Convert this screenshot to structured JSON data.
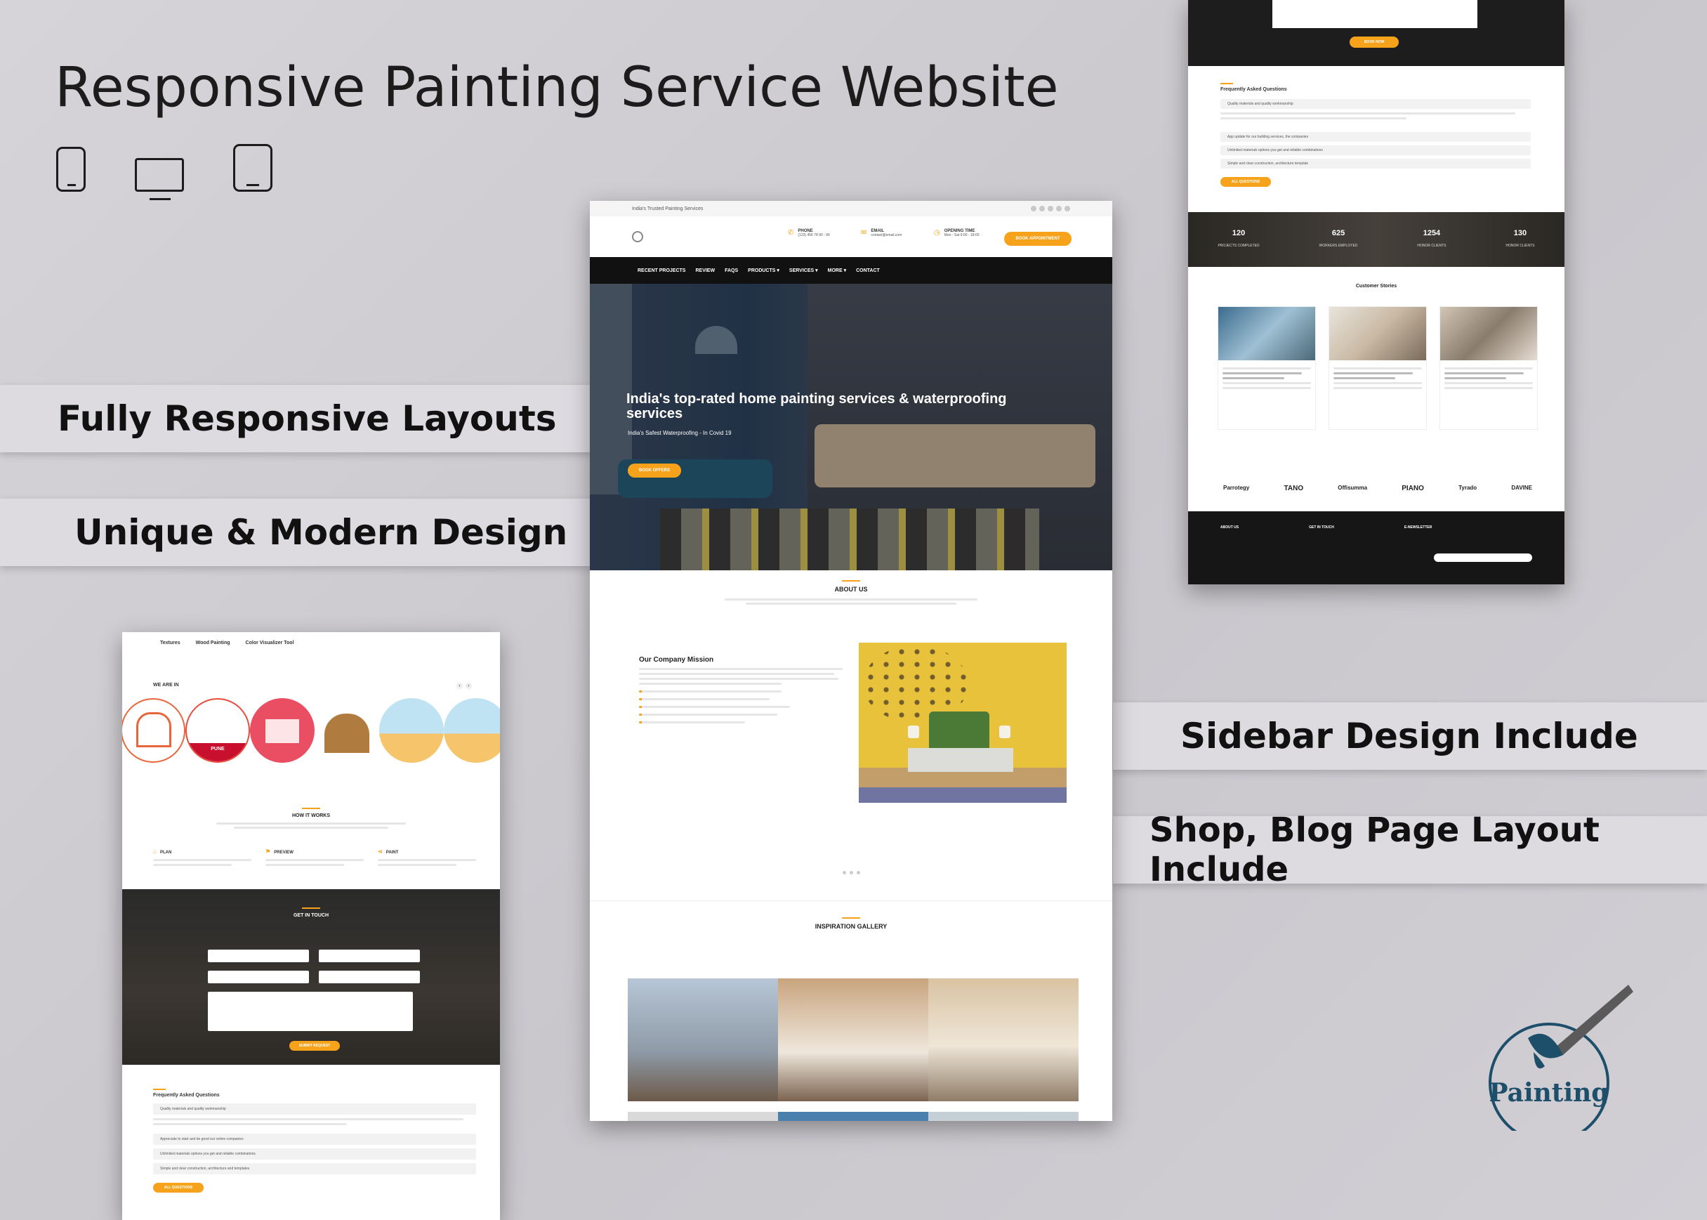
{
  "headline": "Responsive Painting Service Website",
  "features": {
    "f1": "Fully Responsive Layouts",
    "f2": "Unique & Modern Design",
    "f3": "Sidebar Design Include",
    "f4": "Shop, Blog Page Layout Include"
  },
  "brand_logo_text": "Painting",
  "colors": {
    "accent": "#f7a21b",
    "dark": "#111111",
    "logo": "#1d4e6a"
  },
  "main": {
    "topbar": "India's Trusted Painting Services",
    "phone_label": "PHONE",
    "phone_value": "(123) 456 78 90 - 99",
    "email_label": "EMAIL",
    "email_value": "contact@email.com",
    "hours_label": "OPENING TIME",
    "hours_value": "Mon - Sat 9:00 - 18:00",
    "book_button": "BOOK APPOINTMENT",
    "nav": [
      "RECENT PROJECTS",
      "REVIEW",
      "FAQS",
      "PRODUCTS ▾",
      "SERVICES ▾",
      "MORE ▾",
      "CONTACT"
    ],
    "hero_title": "India's top-rated home painting services & waterproofing services",
    "hero_sub": "India's Safest Waterproofing - In Covid 19",
    "hero_button": "BOOK OFFERS",
    "about_title": "ABOUT US",
    "mission_title": "Our Company Mission",
    "gallery_title": "INSPIRATION GALLERY"
  },
  "left": {
    "tabs": [
      "Textures",
      "Wood Painting",
      "Color Visualizer Tool"
    ],
    "we_are_in": "WE ARE IN",
    "city_labels": [
      "PUNE"
    ],
    "how_title": "HOW IT WORKS",
    "steps": [
      "PLAN",
      "PREVIEW",
      "PAINT"
    ],
    "touch_title": "GET IN TOUCH",
    "submit": "SUBMIT REQUEST",
    "faq_title": "Frequently Asked Questions",
    "faq_items": [
      "Quality materials and quality workmanship",
      "Appreciate to start and be good our online companies",
      "Unlimited materials options you get and reliable combinations",
      "Simple and clear construction, architecture and templates"
    ],
    "all_q": "ALL QUESTIONS"
  },
  "right": {
    "button": "BOOK NOW",
    "faq_title": "Frequently Asked Questions",
    "faq_items": [
      "Quality materials and quality workmanship",
      "App update for our building services, the companies",
      "Unlimited materials options you get and reliable combinations",
      "Simple and clear construction, architecture template"
    ],
    "all_q": "ALL QUESTIONS",
    "stats": [
      {
        "value": "120",
        "label": "PROJECTS COMPLETED"
      },
      {
        "value": "625",
        "label": "WORKERS EMPLOYED"
      },
      {
        "value": "1254",
        "label": "HONOR CLIENTS"
      },
      {
        "value": "130",
        "label": "HONOR CLIENTS"
      }
    ],
    "stories_title": "Customer Stories",
    "brands": [
      "Parrotegy",
      "TANO",
      "Offisumma",
      "PIANO",
      "Tyrado",
      "DAVINE"
    ],
    "footer": [
      "ABOUT US",
      "GET IN TOUCH",
      "E-NEWSLETTER"
    ]
  }
}
